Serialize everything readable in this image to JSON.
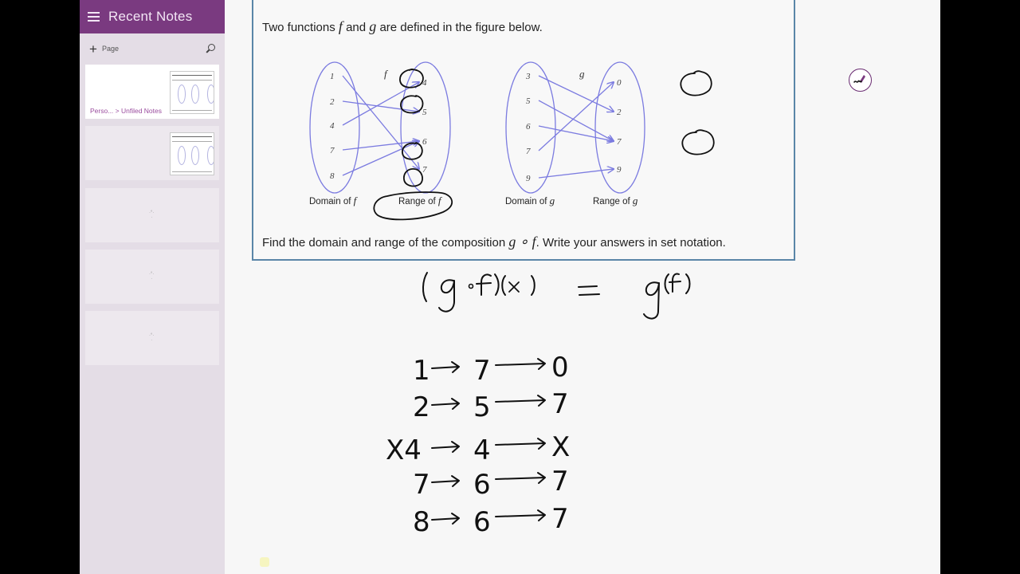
{
  "sidebar": {
    "title": "Recent Notes",
    "menu_icon": "hamburger-icon",
    "new_page_label": "Page",
    "search_icon": "search-icon",
    "notes": [
      {
        "breadcrumb": "Perso...  > Unfiled Notes",
        "has_thumbnail": true,
        "active": true
      },
      {
        "breadcrumb": "",
        "has_thumbnail": true,
        "active": false
      },
      {
        "breadcrumb": "",
        "has_thumbnail": false,
        "loading": true,
        "active": false
      },
      {
        "breadcrumb": "",
        "has_thumbnail": false,
        "loading": true,
        "active": false
      },
      {
        "breadcrumb": "",
        "has_thumbnail": false,
        "loading": true,
        "active": false
      }
    ]
  },
  "problem": {
    "intro_pre": "Two functions",
    "f": "f",
    "and": "and",
    "g": "g",
    "intro_post": "are defined in the figure below.",
    "question_pre": "Find the domain and range of the composition",
    "compose": "g ∘ f",
    "question_post": ". Write your answers in set notation.",
    "f_mapping": {
      "label": "f",
      "domain_label": "Domain of",
      "range_label": "Range of",
      "domain": [
        "1",
        "2",
        "4",
        "7",
        "8"
      ],
      "range": [
        "4",
        "5",
        "6",
        "7"
      ],
      "arrows": [
        [
          "1",
          "7"
        ],
        [
          "2",
          "5"
        ],
        [
          "4",
          "4"
        ],
        [
          "7",
          "6"
        ],
        [
          "8",
          "6"
        ]
      ]
    },
    "g_mapping": {
      "label": "g",
      "domain_label": "Domain of",
      "range_label": "Range of",
      "domain": [
        "3",
        "5",
        "6",
        "7",
        "9"
      ],
      "range": [
        "0",
        "2",
        "7",
        "9"
      ],
      "arrows": [
        [
          "3",
          "2"
        ],
        [
          "5",
          "7"
        ],
        [
          "6",
          "7"
        ],
        [
          "7",
          "0"
        ],
        [
          "9",
          "9"
        ]
      ]
    }
  },
  "handwriting": {
    "equation": "(g∘f)(x) = g(f)",
    "rows": [
      {
        "x": "1",
        "fx": "7",
        "gfx": "0"
      },
      {
        "x": "2",
        "fx": "5",
        "gfx": "7"
      },
      {
        "x": "X4",
        "fx": "4",
        "gfx": "X"
      },
      {
        "x": "7",
        "fx": "6",
        "gfx": "7"
      },
      {
        "x": "8",
        "fx": "6",
        "gfx": "7"
      }
    ]
  },
  "tools": {
    "pen_button": "pen-icon"
  },
  "colors": {
    "accent": "#7a3a80",
    "diagram_blue": "#7b7be0",
    "box_border": "#5a86a8",
    "ink": "#111111"
  }
}
